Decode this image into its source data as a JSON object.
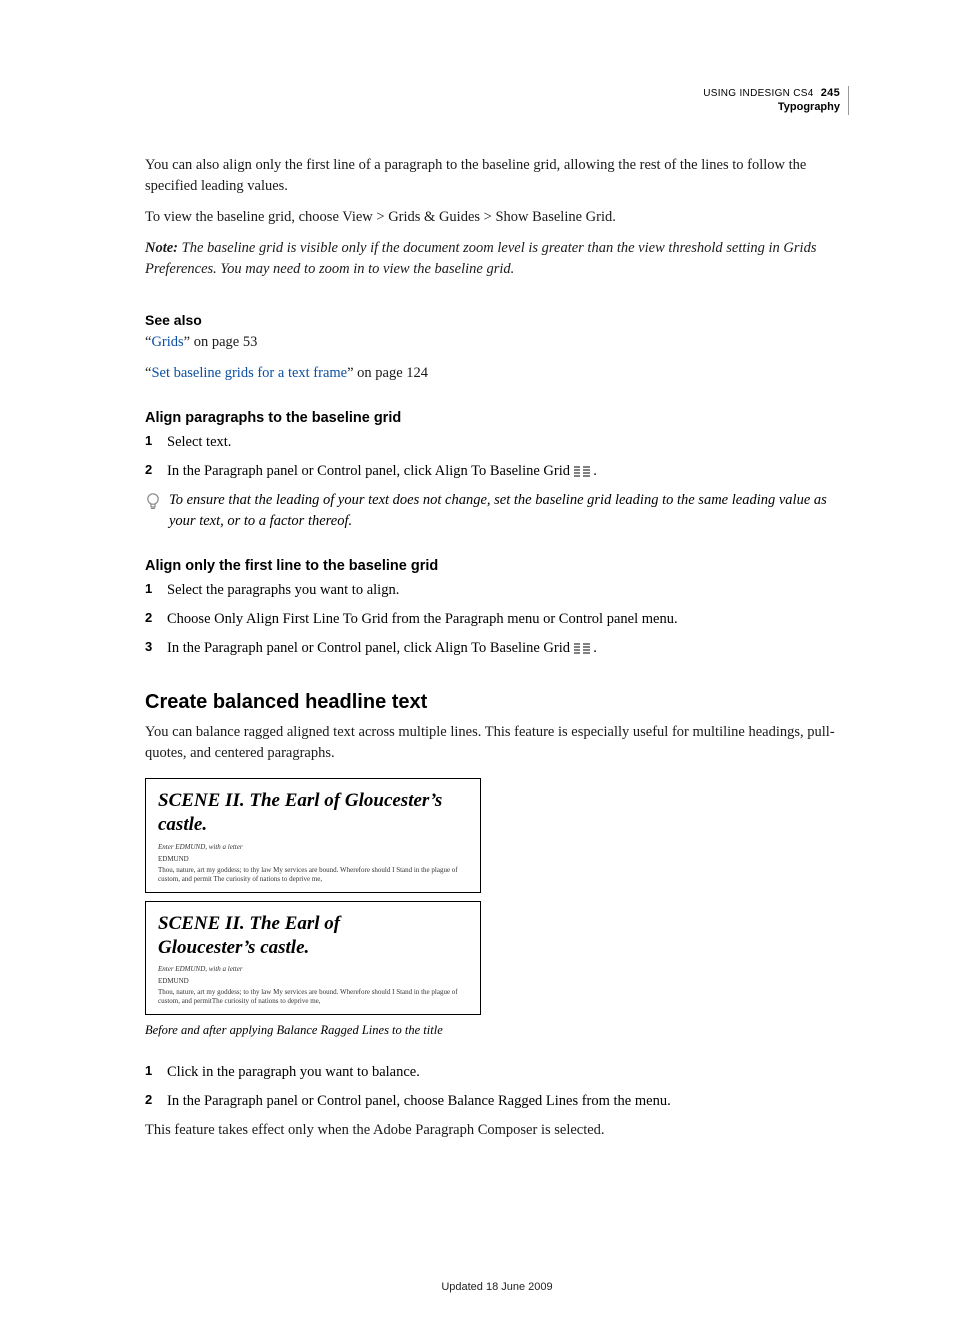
{
  "header": {
    "doc_title": "USING INDESIGN CS4",
    "page_number": "245",
    "chapter": "Typography"
  },
  "intro": {
    "p1": "You can also align only the first line of a paragraph to the baseline grid, allowing the rest of the lines to follow the specified leading values.",
    "p2": "To view the baseline grid, choose View > Grids & Guides > Show Baseline Grid.",
    "note_lead": "Note:",
    "note_body": " The baseline grid is visible only if the document zoom level is greater than the view threshold setting in Grids Preferences. You may need to zoom in to view the baseline grid."
  },
  "see_also": {
    "heading": "See also",
    "link1_pre": "“",
    "link1_text": "Grids",
    "link1_post": "” on page 53",
    "link2_pre": "“",
    "link2_text": "Set baseline grids for a text frame",
    "link2_post": "” on page 124"
  },
  "sec1": {
    "heading": "Align paragraphs to the baseline grid",
    "steps": [
      "Select text.",
      "In the Paragraph panel or Control panel, click Align To Baseline Grid "
    ],
    "step2_tail": " .",
    "tip": "To ensure that the leading of your text does not change, set the baseline grid leading to the same leading value as your text, or to a factor thereof."
  },
  "sec2": {
    "heading": "Align only the first line to the baseline grid",
    "steps": [
      "Select the paragraphs you want to align.",
      "Choose Only Align First Line To Grid from the Paragraph menu or Control panel menu.",
      "In the Paragraph panel or Control panel, click Align To Baseline Grid "
    ],
    "step3_tail": " ."
  },
  "sec3": {
    "heading": "Create balanced headline text",
    "p1": "You can balance ragged aligned text across multiple lines. This feature is especially useful for multiline headings, pull-quotes, and centered paragraphs.",
    "fig": {
      "box1_title": "SCENE II. The Earl of Gloucester’s castle.",
      "box2_title": "SCENE II. The Earl of Gloucester’s castle.",
      "tiny_line1": "Enter EDMUND, with a letter",
      "tiny_line2": "EDMUND",
      "tiny_line3a": "Thou, nature, art my goddess; to thy law My services are bound. Wherefore should I Stand in the plague of custom, and permit The curiosity of nations to deprive me,",
      "tiny_line3b": "Thou, nature, art my goddess; to thy law My services are bound. Wherefore should I Stand in the plague of custom, and permitThe curiosity of nations to deprive me,",
      "caption": "Before and after applying Balance Ragged Lines to the title"
    },
    "steps": [
      "Click in the paragraph you want to balance.",
      "In the Paragraph panel or Control panel, choose Balance Ragged Lines from the menu."
    ],
    "p_last": "This feature takes effect only when the Adobe Paragraph Composer is selected."
  },
  "footer": "Updated 18 June 2009"
}
